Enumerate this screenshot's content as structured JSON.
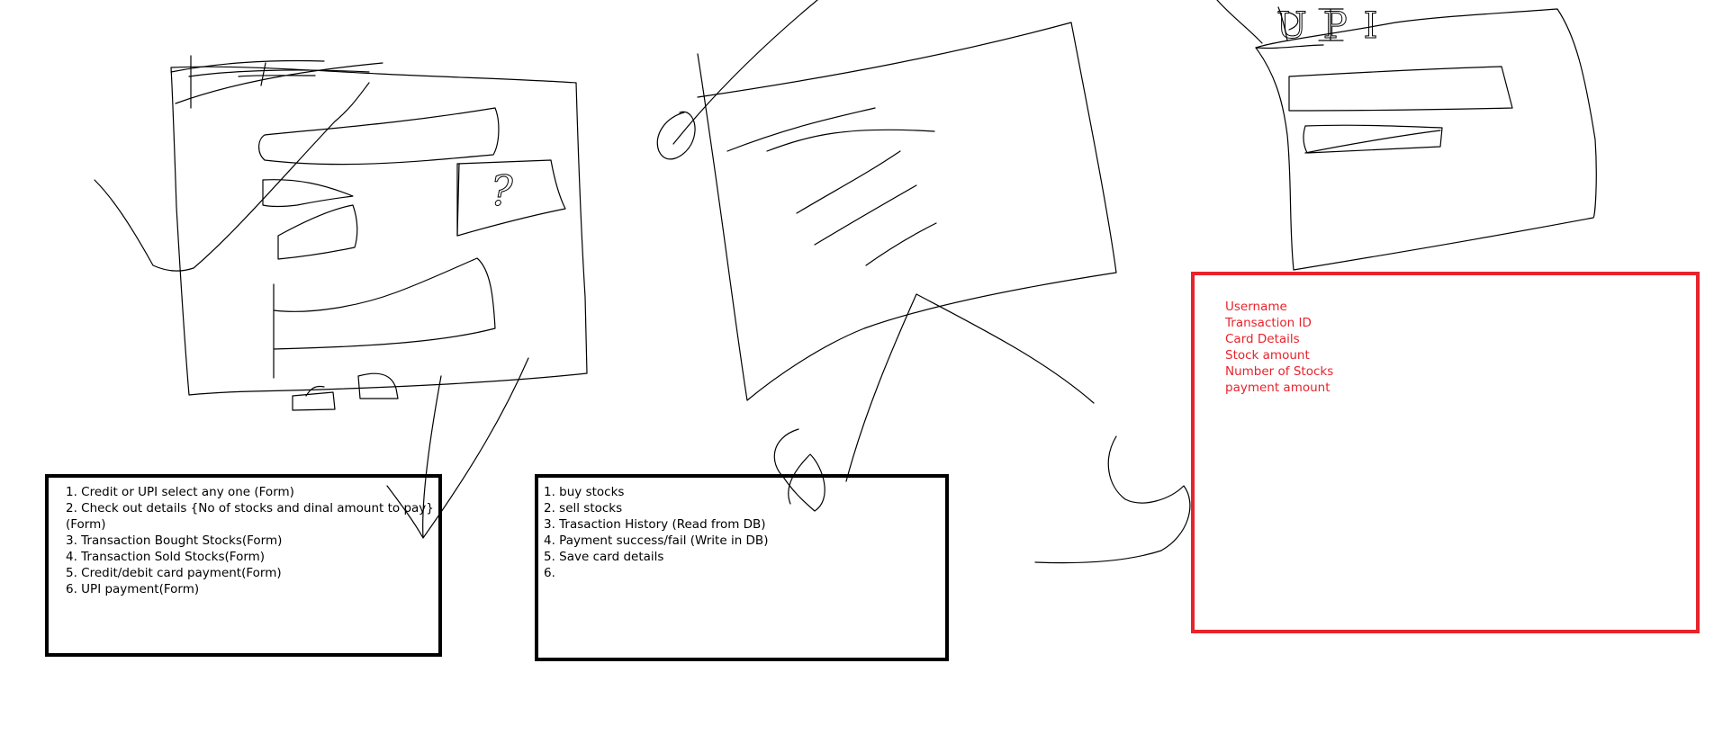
{
  "sketch_labels": {
    "question_mark": "?",
    "upi_title": "UPI"
  },
  "forms_box": {
    "items": [
      "1. Credit or UPI select any one (Form)",
      "2. Check out details {No of stocks and dinal amount to pay} (Form)",
      "3. Transaction Bought Stocks(Form)",
      "4. Transaction Sold Stocks(Form)",
      "5. Credit/debit card payment(Form)",
      "6. UPI payment(Form)"
    ]
  },
  "operations_box": {
    "items": [
      "1. buy stocks",
      "2. sell stocks",
      "3. Trasaction History (Read from DB)",
      "4. Payment success/fail (Write in DB)",
      "5. Save card details",
      "6."
    ]
  },
  "fields_box": {
    "items": [
      "Username",
      "Transaction ID",
      "Card Details",
      "Stock amount",
      "Number of Stocks",
      "payment amount"
    ]
  },
  "colors": {
    "ink": "#000000",
    "red": "#e8232b",
    "background": "#ffffff"
  }
}
